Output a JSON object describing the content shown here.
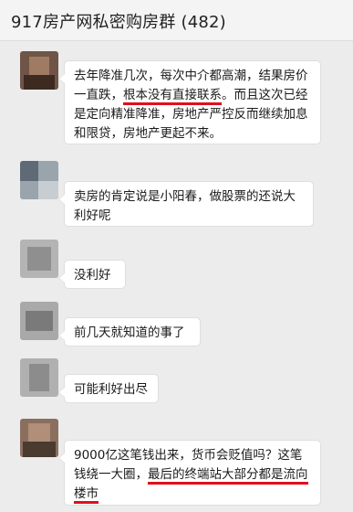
{
  "chat": {
    "title": "917房产网私密购房群 (482)"
  },
  "messages": [
    {
      "segments": [
        {
          "text": "去年降准几次，每次中介都高潮，结果房价一直跌，",
          "underline": false
        },
        {
          "text": "根本没有直接联系",
          "underline": true
        },
        {
          "text": "。而且这次已经是定向精准降准，房地产严控反而继续加息和限贷，房地产更起不来。",
          "underline": false
        }
      ]
    },
    {
      "segments": [
        {
          "text": "卖房的肯定说是小阳春，做股票的还说大利好呢",
          "underline": false
        }
      ]
    },
    {
      "segments": [
        {
          "text": "没利好",
          "underline": false
        }
      ]
    },
    {
      "segments": [
        {
          "text": "前几天就知道的事了",
          "underline": false
        }
      ]
    },
    {
      "segments": [
        {
          "text": "可能利好出尽",
          "underline": false
        }
      ]
    },
    {
      "segments": [
        {
          "text": "9000亿这笔钱出来，货币会贬值吗？这笔钱绕一大圈，",
          "underline": false
        },
        {
          "text": "最后的终端站大部分都是流向楼市",
          "underline": true
        }
      ]
    }
  ],
  "colors": {
    "background": "#ececec",
    "bubble": "#ffffff",
    "underline": "#e0101a"
  }
}
